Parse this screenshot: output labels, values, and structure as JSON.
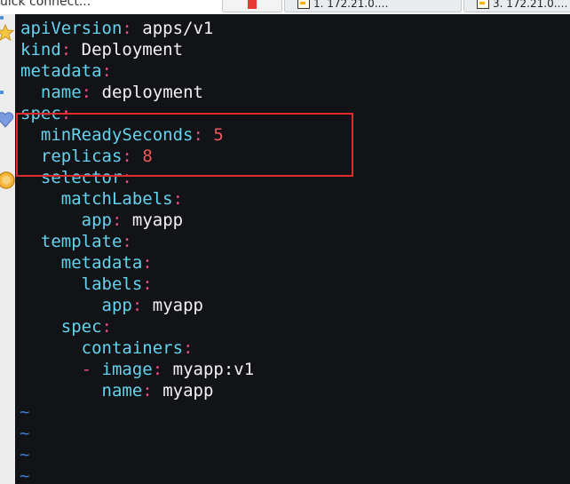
{
  "topbar": {
    "quick_connect_label": "uick connect...",
    "tabs": [
      {
        "label": ""
      },
      {
        "label": "1. 172.21.0.…"
      },
      {
        "label": "3. 172.21.0.…"
      }
    ]
  },
  "sidebar": {
    "icons": [
      "star-icon",
      "heart-icon",
      "coin-icon"
    ]
  },
  "editor": {
    "lines": [
      {
        "indent": "",
        "key": "apiVersion",
        "colon": ":",
        "value": "apps/v1"
      },
      {
        "indent": "",
        "key": "kind",
        "colon": ":",
        "value": "Deployment"
      },
      {
        "indent": "",
        "key": "metadata",
        "colon": ":",
        "value": ""
      },
      {
        "indent": "  ",
        "key": "name",
        "colon": ":",
        "value": "deployment"
      },
      {
        "indent": "",
        "key": "spec",
        "colon": ":",
        "value": ""
      },
      {
        "indent": "  ",
        "key": "minReadySeconds",
        "colon": ":",
        "value": "5",
        "numeric": true
      },
      {
        "indent": "  ",
        "key": "replicas",
        "colon": ":",
        "value": "8",
        "numeric": true
      },
      {
        "indent": "  ",
        "key": "selector",
        "colon": ":",
        "value": ""
      },
      {
        "indent": "    ",
        "key": "matchLabels",
        "colon": ":",
        "value": ""
      },
      {
        "indent": "      ",
        "key": "app",
        "colon": ":",
        "value": "myapp"
      },
      {
        "indent": "  ",
        "key": "template",
        "colon": ":",
        "value": ""
      },
      {
        "indent": "    ",
        "key": "metadata",
        "colon": ":",
        "value": ""
      },
      {
        "indent": "      ",
        "key": "labels",
        "colon": ":",
        "value": ""
      },
      {
        "indent": "        ",
        "key": "app",
        "colon": ":",
        "value": "myapp"
      },
      {
        "indent": "    ",
        "key": "spec",
        "colon": ":",
        "value": ""
      },
      {
        "indent": "      ",
        "key": "containers",
        "colon": ":",
        "value": ""
      },
      {
        "indent": "      ",
        "dash": "- ",
        "key": "image",
        "colon": ":",
        "value": "myapp:v1"
      },
      {
        "indent": "        ",
        "key": "name",
        "colon": ":",
        "value": "myapp"
      }
    ],
    "tildes": [
      "~",
      "~",
      "~",
      "~"
    ],
    "highlight_color": "#e02b2b"
  },
  "colors": {
    "terminal_bg": "#121316",
    "key": "#63d3ee",
    "punct": "#e84a8a",
    "value": "#f2f2f2",
    "number": "#f05a5a",
    "tilde": "#3f7bd8"
  }
}
